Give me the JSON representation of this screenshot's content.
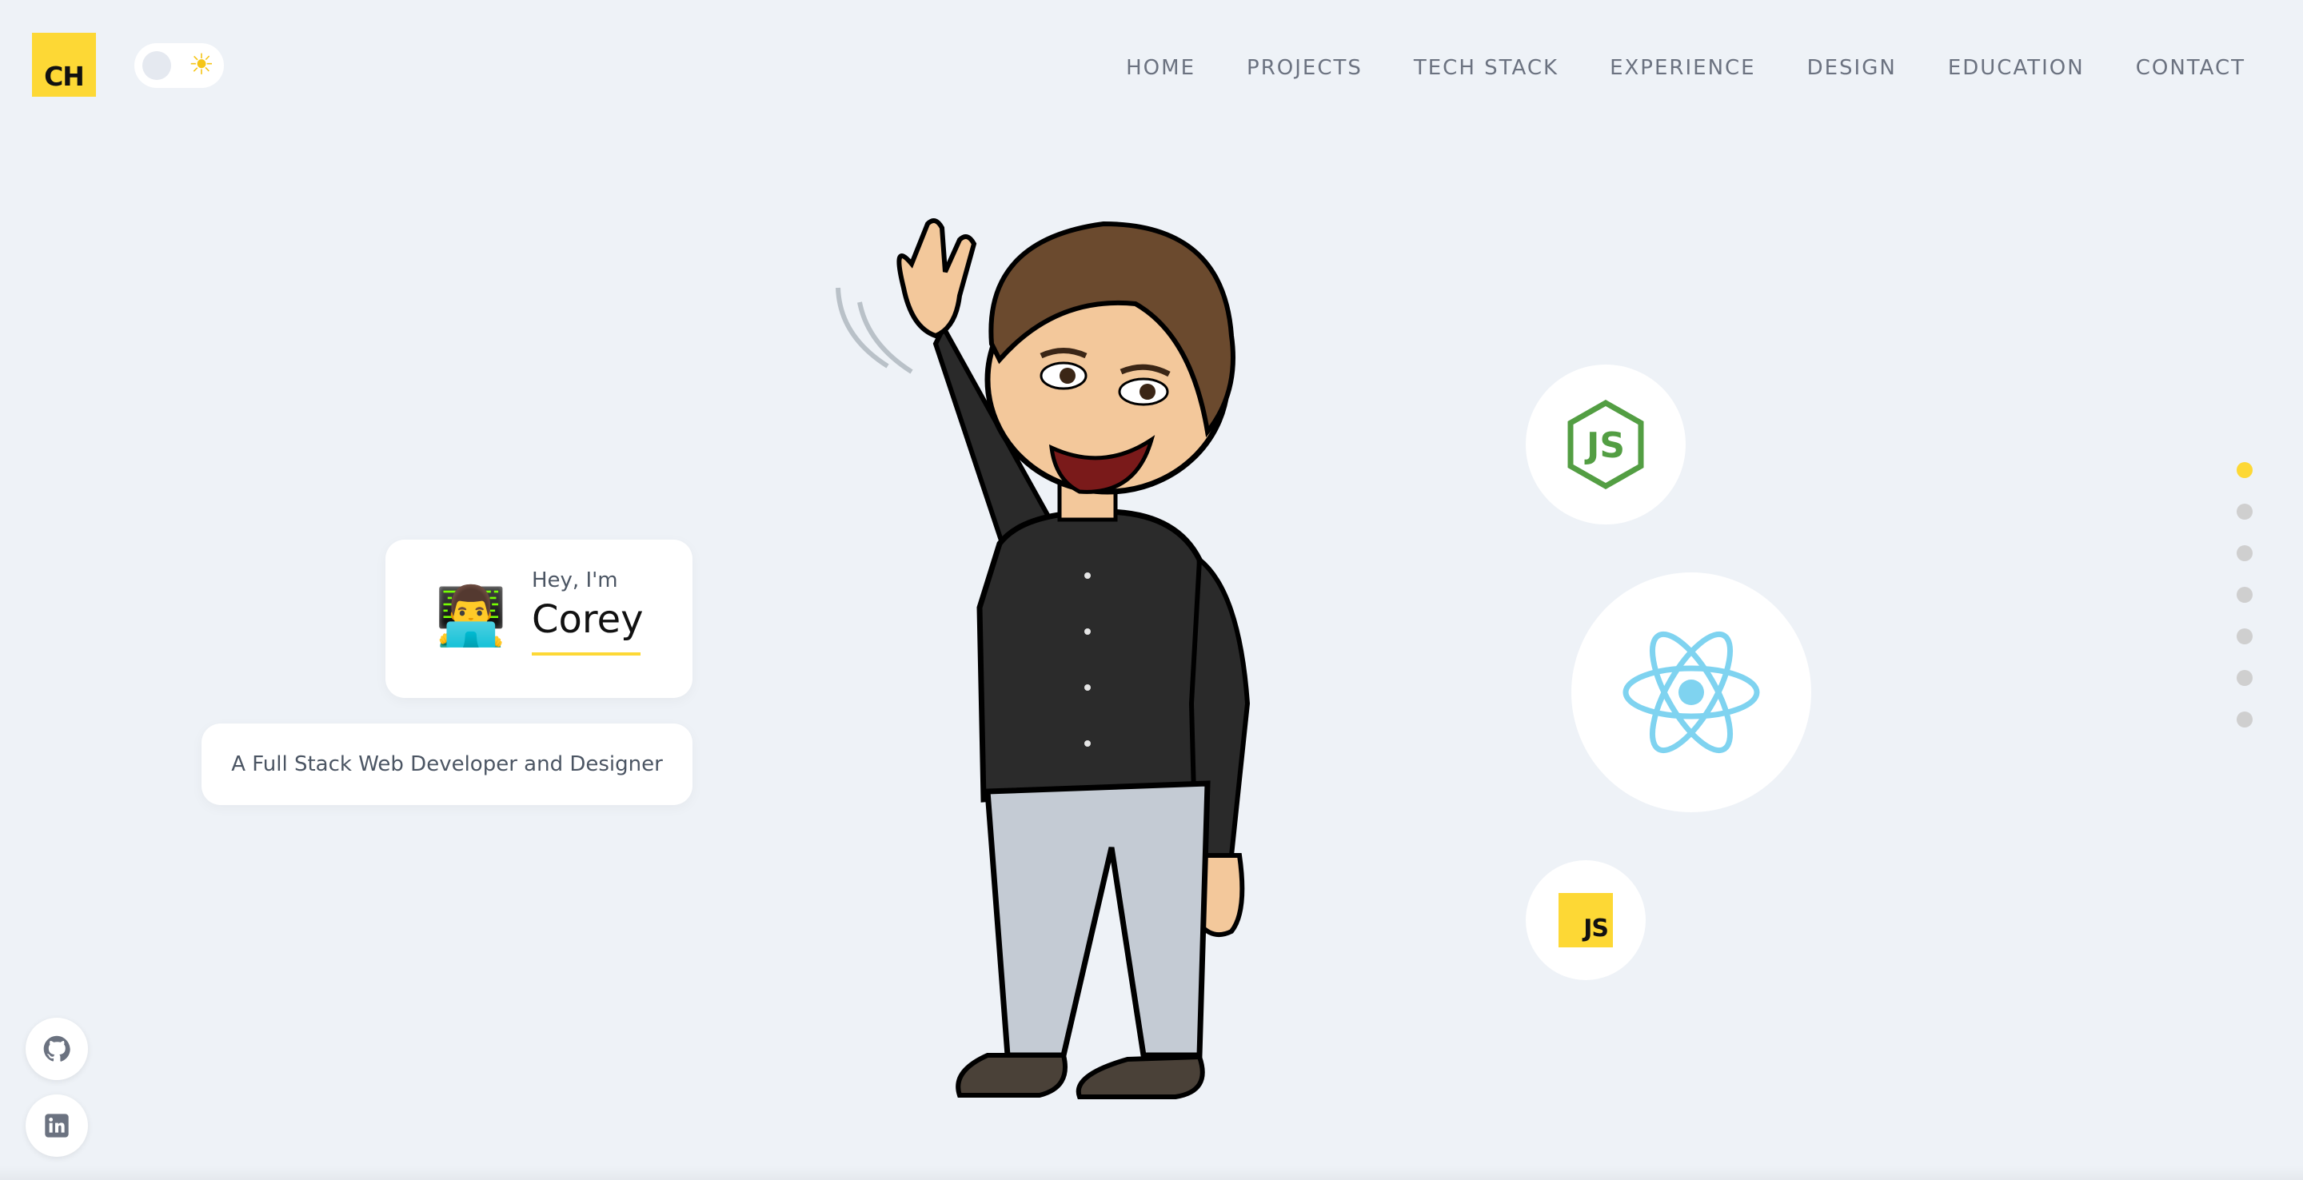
{
  "logo": {
    "text": "CH",
    "color": "#fdd835"
  },
  "theme_toggle": {
    "icon": "sun-icon",
    "state": "light"
  },
  "nav": {
    "items": [
      {
        "label": "HOME"
      },
      {
        "label": "PROJECTS"
      },
      {
        "label": "TECH STACK"
      },
      {
        "label": "EXPERIENCE"
      },
      {
        "label": "DESIGN"
      },
      {
        "label": "EDUCATION"
      },
      {
        "label": "CONTACT"
      }
    ]
  },
  "hero": {
    "greeting": "Hey, I'm",
    "name": "Corey",
    "emoji": "👨‍💻",
    "subtitle": "A Full Stack Web Developer and Designer",
    "avatar": "waving-cartoon-avatar"
  },
  "tech_icons": {
    "node": {
      "icon": "nodejs-icon",
      "color": "#539e43"
    },
    "react": {
      "icon": "react-icon",
      "color": "#7fd3f0"
    },
    "javascript": {
      "icon": "javascript-icon",
      "text": "JS",
      "color": "#fdd835"
    }
  },
  "section_dots": {
    "count": 7,
    "active_index": 0,
    "active_color": "#fdd835"
  },
  "social": [
    {
      "icon": "github-icon"
    },
    {
      "icon": "linkedin-icon"
    }
  ],
  "colors": {
    "background": "#eef2f7",
    "accent": "#fdd835",
    "text": "#4b5563"
  }
}
